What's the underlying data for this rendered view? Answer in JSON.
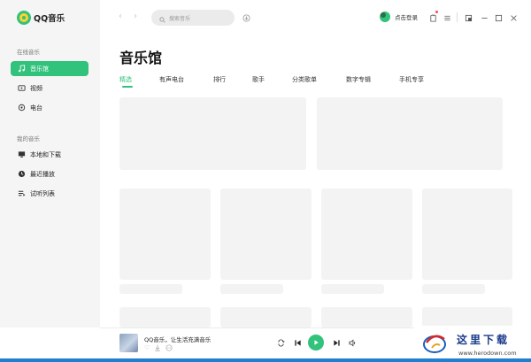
{
  "app": {
    "logo_text": "QQ音乐"
  },
  "sidebar": {
    "online_title": "在线音乐",
    "online_items": [
      {
        "label": "音乐馆",
        "icon": "music-note-icon",
        "active": true
      },
      {
        "label": "视频",
        "icon": "video-icon",
        "active": false
      },
      {
        "label": "电台",
        "icon": "radio-icon",
        "active": false
      }
    ],
    "my_title": "我的音乐",
    "my_items": [
      {
        "label": "本地和下载",
        "icon": "computer-icon"
      },
      {
        "label": "最近播放",
        "icon": "clock-icon"
      },
      {
        "label": "试听列表",
        "icon": "playlist-icon"
      }
    ]
  },
  "topbar": {
    "search_placeholder": "搜索音乐",
    "login_text": "点击登录"
  },
  "main": {
    "title": "音乐馆",
    "tabs": [
      {
        "label": "精选",
        "active": true
      },
      {
        "label": "有声电台",
        "active": false
      },
      {
        "label": "排行",
        "active": false
      },
      {
        "label": "歌手",
        "active": false
      },
      {
        "label": "分类歌单",
        "active": false
      },
      {
        "label": "数字专辑",
        "active": false
      },
      {
        "label": "手机专享",
        "active": false
      }
    ]
  },
  "player": {
    "song_title": "QQ音乐，让生活充满音乐"
  },
  "watermark": {
    "title": "这里下载",
    "url": "www.herodown.com"
  },
  "colors": {
    "accent": "#31c27c",
    "placeholder": "#f3f3f3",
    "sidebar_bg": "#f5f5f5"
  }
}
